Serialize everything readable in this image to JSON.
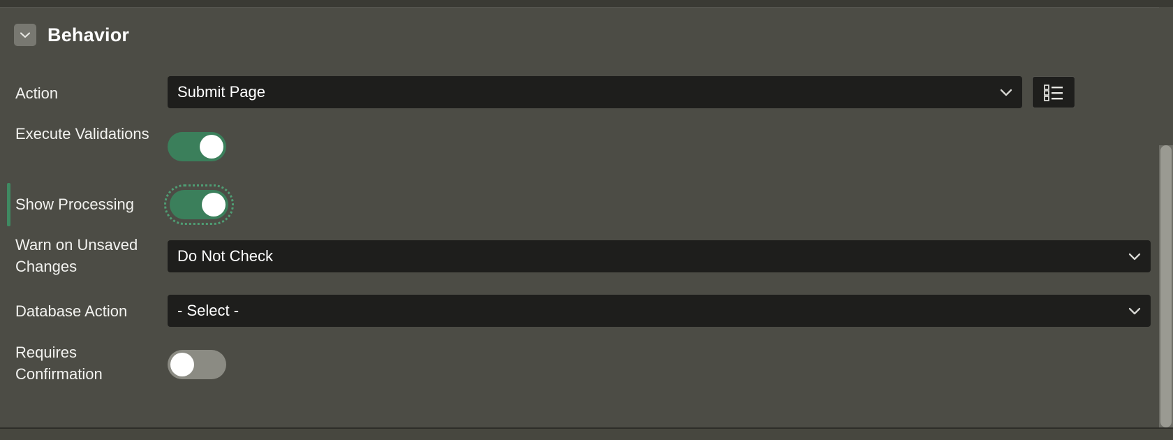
{
  "theme": {
    "panel_bg": "#4c4c45",
    "field_bg": "#1e1e1c",
    "toggle_on": "#3b7f5b",
    "toggle_off": "#8b8b83",
    "accent_indicator": "#3f8a62",
    "text": "#f2f2ef",
    "scrollbar": "#9a9a92"
  },
  "section": {
    "title": "Behavior",
    "collapse_icon": "chevron-down-icon",
    "expanded": true
  },
  "properties": [
    {
      "key": "action",
      "label": "Action",
      "control": "select-with-lov",
      "value": "Submit Page",
      "arrow_icon": "chevron-down-icon",
      "lov_icon": "list-select-icon",
      "has_indicator": false,
      "focused": false
    },
    {
      "key": "execute_validations",
      "label": "Execute Validations",
      "control": "toggle",
      "value": "on",
      "has_indicator": false,
      "focused": false
    },
    {
      "key": "show_processing",
      "label": "Show Processing",
      "control": "toggle",
      "value": "on",
      "has_indicator": true,
      "focused": true
    },
    {
      "key": "warn_on_unsaved_changes",
      "label": "Warn on Unsaved Changes",
      "control": "select",
      "value": "Do Not Check",
      "arrow_icon": "chevron-down-icon",
      "has_indicator": false,
      "focused": false
    },
    {
      "key": "database_action",
      "label": "Database Action",
      "control": "select",
      "value": "- Select -",
      "arrow_icon": "chevron-down-icon",
      "has_indicator": false,
      "focused": false
    },
    {
      "key": "requires_confirmation",
      "label": "Requires Confirmation",
      "control": "toggle",
      "value": "off",
      "has_indicator": false,
      "focused": false
    }
  ],
  "scrollbar": {
    "visible": true,
    "orientation": "vertical"
  }
}
